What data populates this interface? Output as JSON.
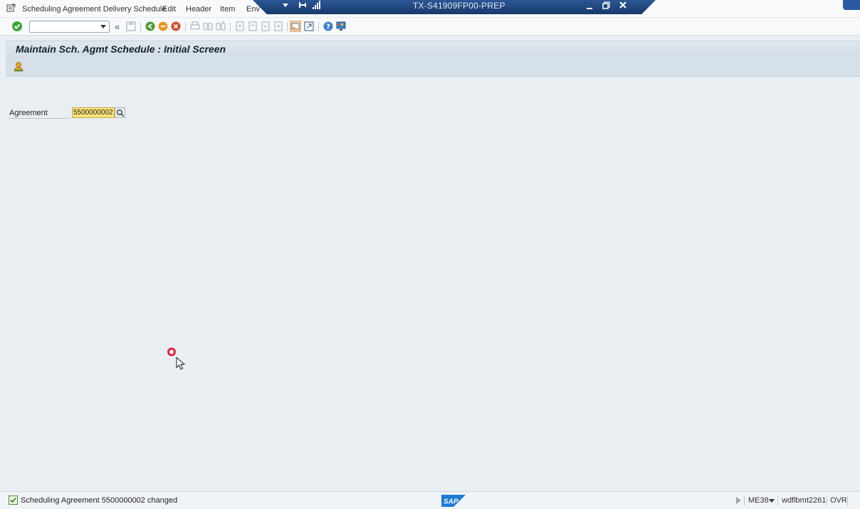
{
  "menubar": {
    "items": [
      "Scheduling Agreement Delivery Schedule",
      "Edit",
      "Header",
      "Item",
      "Env"
    ]
  },
  "remote_session": {
    "title": "TX-S41909FP00-PREP"
  },
  "toolbar": {
    "command_field_value": ""
  },
  "page": {
    "title": "Maintain Sch. Agmt Schedule : Initial Screen"
  },
  "form": {
    "agreement_label": "Agreement",
    "agreement_value": "5500000002"
  },
  "statusbar": {
    "message": "Scheduling Agreement 5500000002 changed",
    "logo": "SAP",
    "transaction": "ME38",
    "server": "wdflbmt2261",
    "mode": "OVR"
  },
  "colors": {
    "accent_blue": "#2c5794",
    "input_highlight": "#ffe37a",
    "background": "#e9eef3"
  }
}
